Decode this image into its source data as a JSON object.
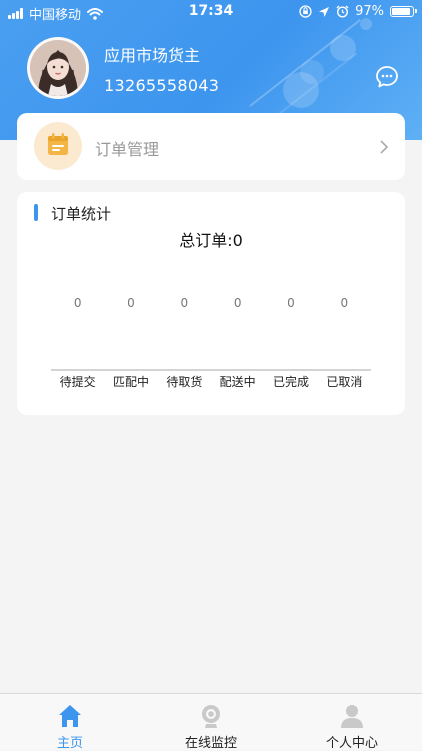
{
  "status_bar": {
    "carrier": "中国移动",
    "time": "17:34",
    "battery": "97%",
    "battery_level": 0.97,
    "icons": [
      "signal-icon",
      "wifi-icon",
      "orientation-lock-icon",
      "location-icon",
      "alarm-icon",
      "battery-icon"
    ]
  },
  "profile": {
    "name": "应用市场货主",
    "phone": "13265558043",
    "avatar_icon": "avatar",
    "message_icon": "chat-bubble-icon"
  },
  "order_management": {
    "label": "订单管理",
    "icon": "calendar-icon",
    "icon_color": "#f3b545"
  },
  "order_stats": {
    "title": "订单统计",
    "total_text": "总订单:0"
  },
  "chart_data": {
    "type": "bar",
    "categories": [
      "待提交",
      "匹配中",
      "待取货",
      "配送中",
      "已完成",
      "已取消"
    ],
    "values": [
      0,
      0,
      0,
      0,
      0,
      0
    ],
    "title": "总订单:0",
    "xlabel": "",
    "ylabel": ""
  },
  "tabbar": {
    "tabs": [
      {
        "label": "主页",
        "icon": "home-icon",
        "active": true
      },
      {
        "label": "在线监控",
        "icon": "camera-icon",
        "active": false
      },
      {
        "label": "个人中心",
        "icon": "person-icon",
        "active": false
      }
    ]
  },
  "colors": {
    "primary": "#3d95ee",
    "header_gradient_start": "#4a9ff0",
    "background": "#f4f4f4",
    "card": "#ffffff"
  }
}
